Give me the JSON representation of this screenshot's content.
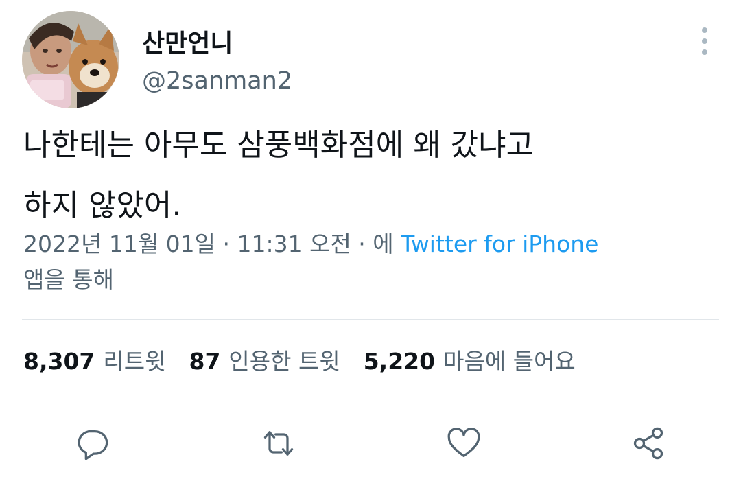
{
  "author": {
    "display_name": "산만언니",
    "handle": "@2sanman2"
  },
  "tweet": {
    "text_line1": "나한테는 아무도 삼풍백화점에 왜 갔냐고",
    "text_line2": "하지 않았어."
  },
  "meta": {
    "timestamp": "2022년 11월 01일 · 11:31 오전 · 에 ",
    "source": "Twitter for iPhone",
    "via_line": "앱을 통해"
  },
  "stats": {
    "retweets_count": "8,307",
    "retweets_label": "리트윗",
    "quotes_count": "87",
    "quotes_label": "인용한 트윗",
    "likes_count": "5,220",
    "likes_label": "마음에 들어요"
  },
  "icons": {
    "more": "more-vertical-icon",
    "reply": "reply-icon",
    "retweet": "retweet-icon",
    "like": "heart-icon",
    "share": "share-icon"
  },
  "colors": {
    "text": "#0f1419",
    "secondary": "#536471",
    "link": "#1d9bf0",
    "icon": "#536471",
    "divider": "#e1e6ea"
  }
}
